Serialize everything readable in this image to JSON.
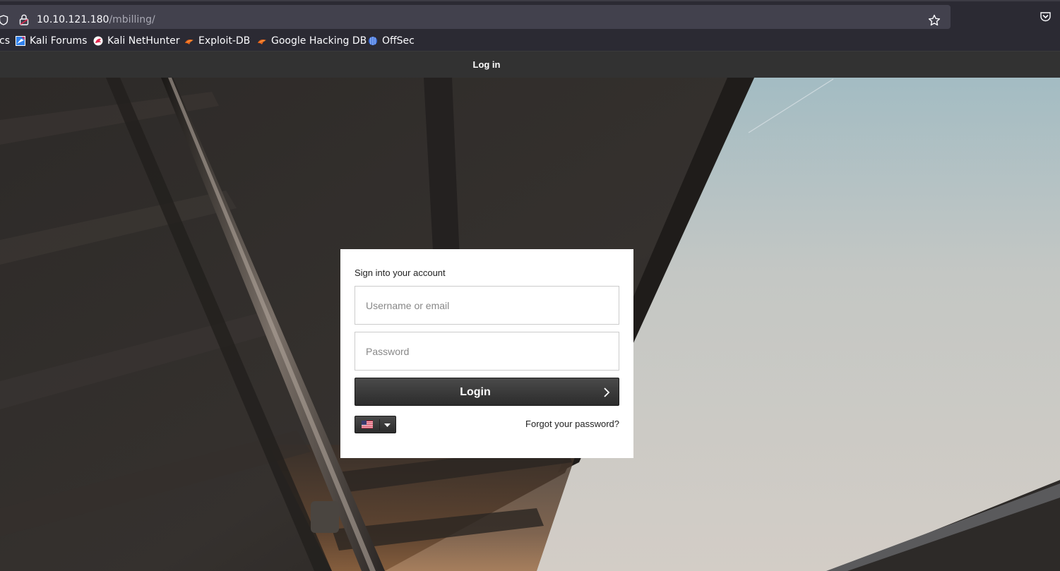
{
  "browser": {
    "url_host": "10.10.121.180",
    "url_path": "/mbilling/",
    "icons": {
      "shield": "shield-icon",
      "lock": "lock-icon",
      "star": "star-icon",
      "pocket": "pocket-icon"
    }
  },
  "bookmarks": [
    {
      "label": "cs",
      "icon": "none"
    },
    {
      "label": "Kali Forums",
      "icon": "kali-forums-icon"
    },
    {
      "label": "Kali NetHunter",
      "icon": "kali-nethunter-icon"
    },
    {
      "label": "Exploit-DB",
      "icon": "exploit-db-icon"
    },
    {
      "label": "Google Hacking DB",
      "icon": "ghdb-icon"
    },
    {
      "label": "OffSec",
      "icon": "offsec-icon"
    }
  ],
  "page": {
    "title": "Log in"
  },
  "login": {
    "heading": "Sign into your account",
    "username_placeholder": "Username or email",
    "username_value": "",
    "password_placeholder": "Password",
    "password_value": "",
    "login_label": "Login",
    "language": "en-US",
    "forgot_label": "Forgot your password?"
  },
  "colors": {
    "browser_bg": "#2b2a33",
    "url_bg": "#42414d",
    "header_bg": "#323232",
    "button_bg": "#333333",
    "card_bg": "#ffffff"
  }
}
